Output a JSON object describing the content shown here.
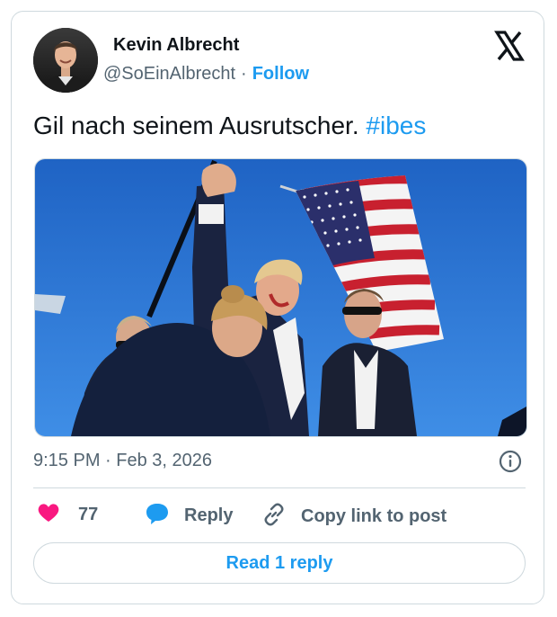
{
  "author": {
    "name": "Kevin Albrecht",
    "handle": "@SoEinAlbrecht",
    "separator": "·",
    "follow_label": "Follow"
  },
  "tweet": {
    "text": "Gil nach seinem Ausrutscher.",
    "hashtag": "#ibes"
  },
  "meta": {
    "time": "9:15 PM",
    "separator": "·",
    "date": "Feb 3, 2026"
  },
  "actions": {
    "like_count": "77",
    "reply_label": "Reply",
    "copy_label": "Copy link to post"
  },
  "read_replies_label": "Read 1 reply",
  "colors": {
    "accent": "#1d9bf0",
    "like": "#f91880",
    "secondary_text": "#536471",
    "border": "#cfd9de"
  },
  "icons": [
    "x-logo-icon",
    "info-icon",
    "heart-icon",
    "reply-bubble-icon",
    "link-icon"
  ]
}
